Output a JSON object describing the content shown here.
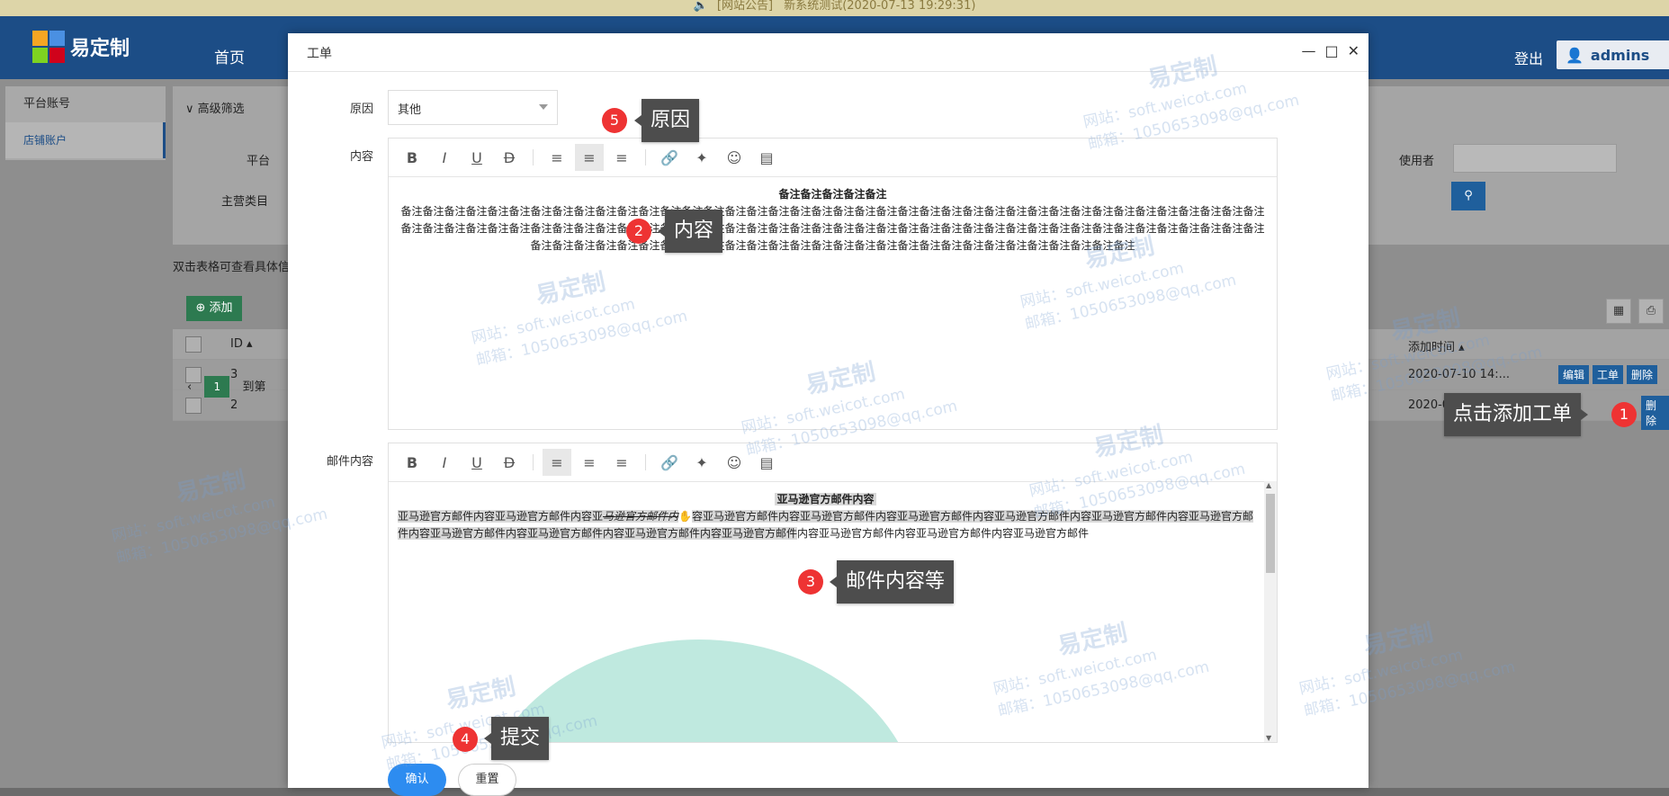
{
  "announcement": {
    "label": "[网站公告]",
    "text": "新系统测试(2020-07-13 19:29:31)"
  },
  "header": {
    "logo_text": "易定制",
    "nav_home": "首页",
    "logout": "登出",
    "user": "admins"
  },
  "sidebar": {
    "items": [
      {
        "label": "平台账号"
      },
      {
        "label": "店铺账户"
      }
    ]
  },
  "filter": {
    "title": "高级筛选",
    "platform_label": "平台",
    "category_label": "主营类目",
    "user_label": "使用者"
  },
  "list": {
    "hint": "双击表格可查看具体信",
    "add_label": "添加",
    "col_id": "ID",
    "col_time": "添加时间",
    "rows": [
      {
        "id": "3",
        "time": "2020-07-10 14:...",
        "edit": "编辑",
        "order": "工单",
        "delete": "删除"
      },
      {
        "id": "2",
        "time": "2020-0",
        "delete": "删除"
      }
    ],
    "page": "1",
    "goto": "到第"
  },
  "modal": {
    "title": "工单",
    "reason_label": "原因",
    "reason_value": "其他",
    "content_label": "内容",
    "content_title": "备注备注备注备注备注",
    "content_body": "备注备注备注备注备注备注备注备注备注备注备注备注备注备注备注备注备注备注备注备注备注备注备注备注备注备注备注备注备注备注备注备注备注备注备注备注备注备注备注备注备注备注备注备注备注备注备注备注备注备注备注备注备注备注备注备注备注备注备注备注备注备注备注备注备注备注备注备注备注备注备注备注备注备注备注备注备注备注备注备注备注备注备注备注备注备注备注备注备注备注备注备注备注备注备注备注备注备注备注备注备注备注备注备注备注备注备注备注",
    "mail_label": "邮件内容",
    "mail_title": "亚马逊官方邮件内容",
    "mail_body_a": "亚马逊官方邮件内容亚马逊官方邮件内容亚",
    "mail_body_strike": "马逊官方邮件内",
    "mail_body_b": "容亚马逊官方邮件内容亚马逊官方邮件内容亚马逊官方邮件内容亚马逊官方邮件内容亚马逊官方邮件内容亚马逊官方邮件内容亚马逊官方邮件内容亚马逊官方邮件内容亚马逊官方邮件内容亚马逊官方邮件",
    "mail_body_c": "内容亚马逊官方邮件内容亚马逊官方邮件内容亚马逊官方邮件",
    "confirm": "确认",
    "reset": "重置"
  },
  "callouts": [
    {
      "num": "1",
      "text": "点击添加工单"
    },
    {
      "num": "2",
      "text": "内容"
    },
    {
      "num": "3",
      "text": "邮件内容等"
    },
    {
      "num": "4",
      "text": "提交"
    },
    {
      "num": "5",
      "text": "原因"
    }
  ],
  "watermark": {
    "brand": "易定制",
    "site": "网站：soft.weicot.com",
    "mail": "邮箱：1050653098@qq.com"
  },
  "colors": {
    "header": "#1c4d86",
    "primary": "#2d8cf0",
    "badge": "#e33333",
    "tooltip": "#4d4d4d"
  }
}
